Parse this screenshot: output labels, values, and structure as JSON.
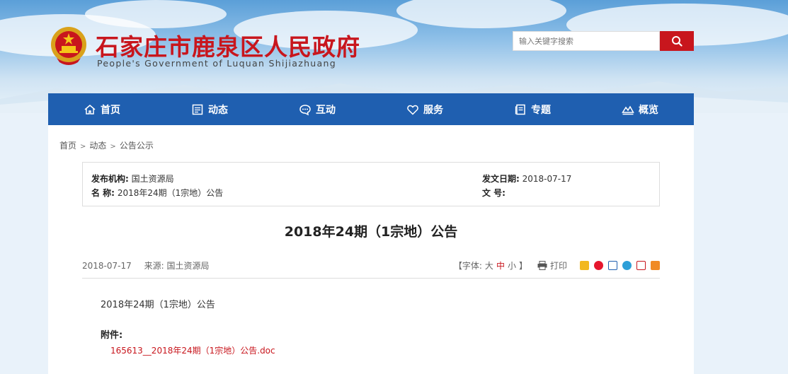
{
  "header": {
    "title": "石家庄市鹿泉区人民政府",
    "subtitle": "People's Government of Luquan Shijiazhuang",
    "search_placeholder": "输入关键字搜索"
  },
  "nav": {
    "items": [
      {
        "label": "首页",
        "icon": "home-icon"
      },
      {
        "label": "动态",
        "icon": "news-icon"
      },
      {
        "label": "互动",
        "icon": "chat-icon"
      },
      {
        "label": "服务",
        "icon": "heart-icon"
      },
      {
        "label": "专题",
        "icon": "topic-icon"
      },
      {
        "label": "概览",
        "icon": "overview-icon"
      }
    ]
  },
  "breadcrumb": [
    "首页",
    "动态",
    "公告公示"
  ],
  "meta": {
    "publisher_label": "发布机构:",
    "publisher": "国土资源局",
    "name_label": "名 称:",
    "name": "2018年24期（1宗地）公告",
    "date_label": "发文日期:",
    "date": "2018-07-17",
    "doc_no_label": "文 号:",
    "doc_no": ""
  },
  "article": {
    "title": "2018年24期（1宗地）公告",
    "date": "2018-07-17",
    "source_label": "来源:",
    "source": "国土资源局",
    "font_label_open": "【字体:",
    "font_large": "大",
    "font_medium": "中",
    "font_small": "小",
    "font_label_close": "】",
    "print_label": "打印",
    "body": "2018年24期（1宗地）公告",
    "attachment_label": "附件:",
    "attachment_link": "165613__2018年24期（1宗地）公告.doc"
  },
  "colors": {
    "brand_red": "#c8161d",
    "nav_blue": "#1f5fb0"
  }
}
